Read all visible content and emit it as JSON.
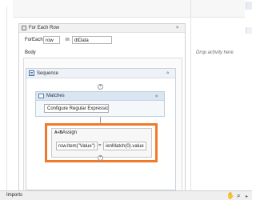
{
  "foreach": {
    "title": "For Each Row",
    "foreach_label": "ForEach",
    "item_value": "row",
    "in_label": "in",
    "collection_value": "dtData",
    "body_label": "Body",
    "collapse_glyph": "»"
  },
  "sequence": {
    "title": "Sequence",
    "collapse_glyph": "»"
  },
  "matches": {
    "title": "Matches",
    "config_button": "Configure Regular Expression...",
    "collapse_glyph": "»"
  },
  "assign": {
    "title": "Assign",
    "icon_text": "A+B",
    "to_value": "row.Item(\"Value\")",
    "equals": "=",
    "value_value": "ienMatch(0).value"
  },
  "canvas": {
    "drop_hint": "Drop activity here",
    "plus_glyph": "+"
  },
  "bottombar": {
    "imports_label": "Imports",
    "pan_icon": "hand-icon",
    "zoom_icon": "zoom-icon"
  },
  "colors": {
    "highlight": "#ef7a2c",
    "matches_header": "#d9e6f2",
    "sequence_header": "#edf2f6"
  }
}
